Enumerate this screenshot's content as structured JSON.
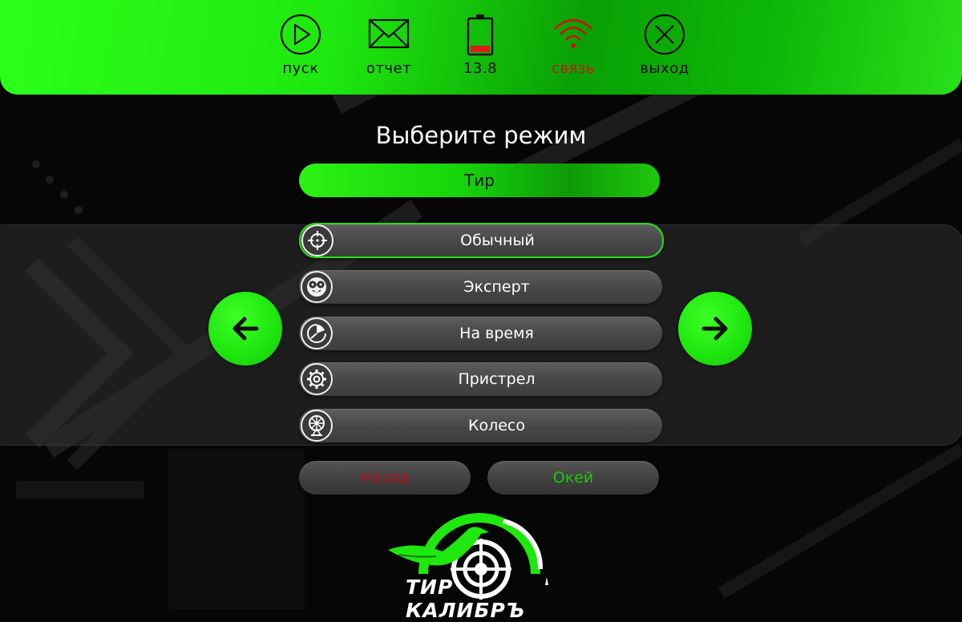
{
  "topbar": {
    "items": [
      {
        "label": "пуск",
        "icon": "play-icon"
      },
      {
        "label": "отчет",
        "icon": "envelope-icon"
      },
      {
        "label": "13.8",
        "icon": "battery-icon"
      },
      {
        "label": "связь",
        "icon": "wifi-icon"
      },
      {
        "label": "выход",
        "icon": "close-circle-icon"
      }
    ]
  },
  "title": "Выберите режим",
  "mode": {
    "label": "Тир"
  },
  "options": [
    {
      "label": "Обычный",
      "icon": "crosshair-icon",
      "selected": true
    },
    {
      "label": "Эксперт",
      "icon": "nerd-face-icon"
    },
    {
      "label": "На время",
      "icon": "timer-icon"
    },
    {
      "label": "Пристрел",
      "icon": "gear-icon"
    },
    {
      "label": "Колесо",
      "icon": "wheel-icon"
    }
  ],
  "buttons": {
    "back": "Назад",
    "ok": "Окей"
  },
  "logo": {
    "text": "ТИР КАЛИБРЪ"
  },
  "colors": {
    "accent": "#1fe80f",
    "back": "#b3121a",
    "ok": "#1fc70f",
    "wifi": "#d01010"
  }
}
